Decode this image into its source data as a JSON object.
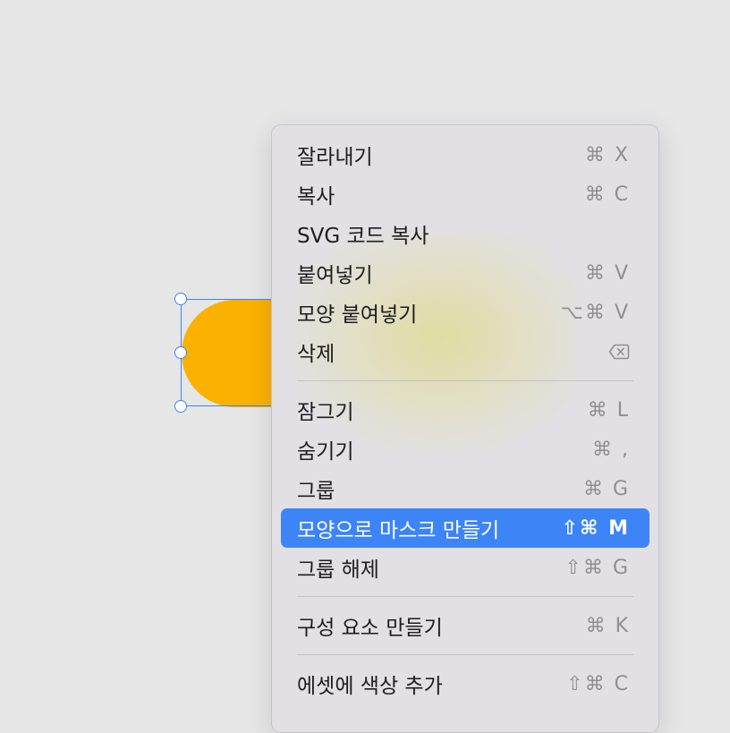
{
  "colors": {
    "background": "#e6e6e6",
    "shape_fill": "#fbb100",
    "selection": "#3b86f6",
    "menu_bg": "#e2e0e5",
    "highlight": "#3d84f7"
  },
  "menu": {
    "groups": [
      [
        {
          "label": "잘라내기",
          "shortcut": "⌘ X"
        },
        {
          "label": "복사",
          "shortcut": "⌘ C"
        },
        {
          "label": "SVG 코드 복사",
          "shortcut": ""
        },
        {
          "label": "붙여넣기",
          "shortcut": "⌘ V"
        },
        {
          "label": "모양 붙여넣기",
          "shortcut": "⌥⌘ V"
        },
        {
          "label": "삭제",
          "shortcut_icon": "delete-backward-icon"
        }
      ],
      [
        {
          "label": "잠그기",
          "shortcut": "⌘ L"
        },
        {
          "label": "숨기기",
          "shortcut": "⌘ ,"
        },
        {
          "label": "그룹",
          "shortcut": "⌘ G"
        },
        {
          "label": "모양으로 마스크 만들기",
          "shortcut": "⇧⌘ M",
          "highlighted": true
        },
        {
          "label": "그룹 해제",
          "shortcut": "⇧⌘ G"
        }
      ],
      [
        {
          "label": "구성 요소 만들기",
          "shortcut": "⌘ K"
        }
      ],
      [
        {
          "label": "에셋에 색상 추가",
          "shortcut": "⇧⌘ C"
        }
      ]
    ]
  }
}
